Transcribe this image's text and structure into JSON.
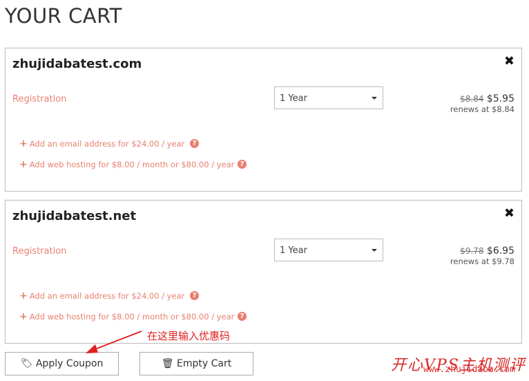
{
  "page_title": "YOUR CART",
  "items": [
    {
      "domain": "zhujidabatest.com",
      "type": "Registration",
      "period": "1 Year",
      "old_price": "$8.84",
      "price": "$5.95",
      "renews": "renews at $8.84",
      "addons": [
        "Add an email address for $24.00 / year",
        "Add web hosting for $8.00 / month or $80.00 / year"
      ]
    },
    {
      "domain": "zhujidabatest.net",
      "type": "Registration",
      "period": "1 Year",
      "old_price": "$9.78",
      "price": "$6.95",
      "renews": "renews at $9.78",
      "addons": [
        "Add an email address for $24.00 / year",
        "Add web hosting for $8.00 / month or $80.00 / year"
      ]
    }
  ],
  "buttons": {
    "apply_coupon": "Apply Coupon",
    "empty_cart": "Empty Cart"
  },
  "annotation": "在这里输入优惠码",
  "watermark": {
    "title": "开心VPS主机测评",
    "url": "www.zhujidaba.com"
  },
  "colors": {
    "accent": "#e8806f",
    "annotation": "#e02020"
  }
}
